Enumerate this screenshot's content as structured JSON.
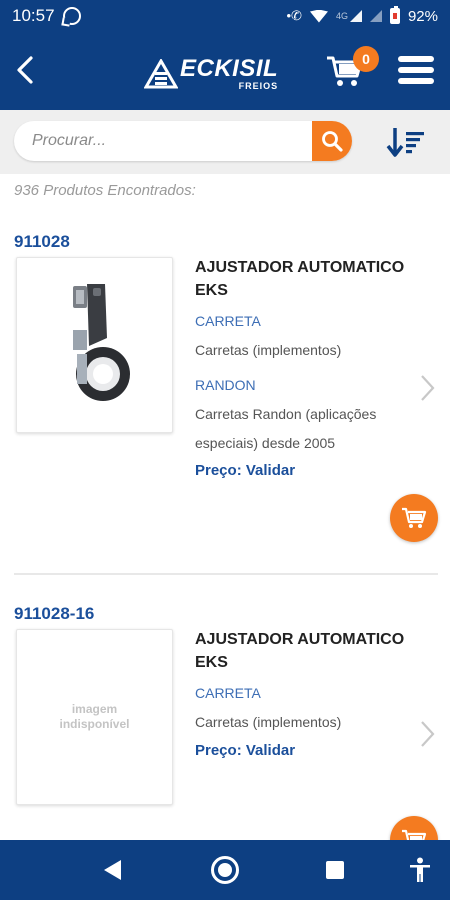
{
  "status_bar": {
    "time": "10:57",
    "network": "4G",
    "battery": "92%"
  },
  "header": {
    "brand_name": "ECKISIL",
    "brand_sub": "FREIOS",
    "cart_count": "0"
  },
  "search": {
    "placeholder": "Procurar..."
  },
  "results": {
    "count_text": "936 Produtos Encontrados:"
  },
  "products": [
    {
      "code": "911028",
      "name": "AJUSTADOR AUTOMATICO EKS",
      "category1_label": "CARRETA",
      "category1_desc": "Carretas (implementos)",
      "category2_label": "RANDON",
      "category2_desc": "Carretas Randon (aplicações especiais) desde 2005",
      "price_text": "Preço: Validar",
      "has_image": true
    },
    {
      "code": "911028-16",
      "name": "AJUSTADOR AUTOMATICO EKS",
      "category1_label": "CARRETA",
      "category1_desc": "Carretas (implementos)",
      "price_text": "Preço: Validar",
      "image_unavailable_line1": "imagem",
      "image_unavailable_line2": "indisponível",
      "has_image": false
    }
  ],
  "colors": {
    "primary": "#0d3f82",
    "accent": "#f47b20",
    "link": "#1b4f9b"
  }
}
